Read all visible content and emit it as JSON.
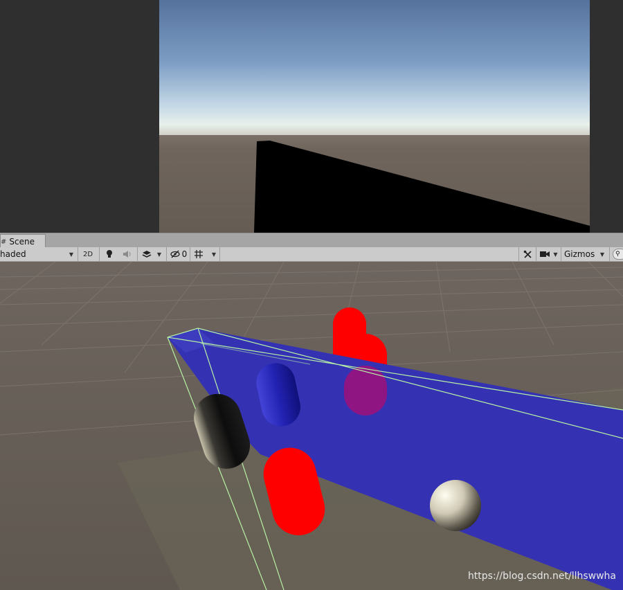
{
  "scene_tab": {
    "label": "Scene",
    "icon": "hash-icon"
  },
  "toolbar": {
    "shading_mode": "haded",
    "toggle_2d": "2D",
    "hidden_count": "0",
    "gizmos_label": "Gizmos"
  },
  "icons": {
    "lighting": "lightbulb-icon",
    "audio": "speaker-icon",
    "effects": "layers-icon",
    "visibility": "eye-slash-icon",
    "grid": "grid-icon",
    "tools": "tools-icon",
    "camera": "camera-icon",
    "search": "search-icon"
  },
  "watermark": "https://blog.csdn.net/llhswwha",
  "colors": {
    "editor_bg": "#2f2f2f",
    "toolbar_bg": "#cbcbcb",
    "tab_bar_bg": "#a5a5a5",
    "sky_top": "#5a7aa6",
    "ground": "#6e655d",
    "plane_blue": "#3432b3",
    "capsule_red": "#ff0000",
    "capsule_blue": "#2424b0",
    "selection_outline": "#b8f3a4"
  }
}
